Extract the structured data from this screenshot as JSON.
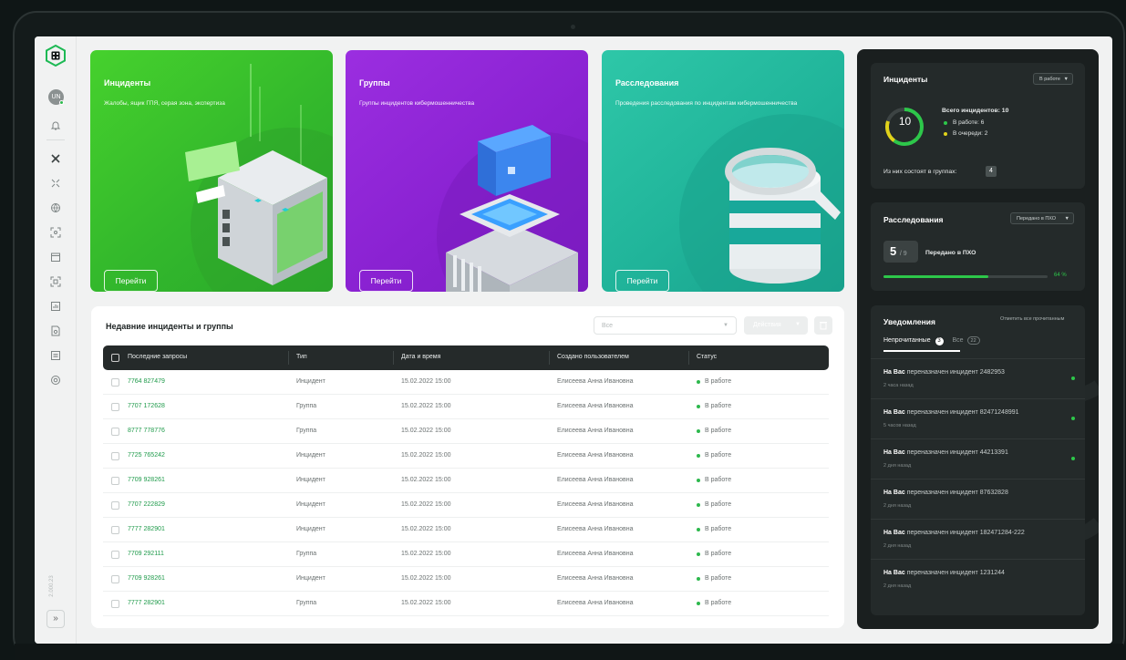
{
  "sidebar": {
    "avatar_initials": "UN",
    "version": "2.000.23",
    "expand_label": "»"
  },
  "cards": [
    {
      "title": "Инциденты",
      "description": "Жалобы, ящик ГПЯ, серая зона, экспертиза",
      "button": "Перейти",
      "color": "#3fc72f"
    },
    {
      "title": "Группы",
      "description": "Группы инцидентов кибермошенничества",
      "button": "Перейти",
      "color": "#8b24d6"
    },
    {
      "title": "Расследования",
      "description": "Проведения расследования по инцидентам кибермошенничества",
      "button": "Перейти",
      "color": "#21b79a"
    }
  ],
  "table_panel": {
    "title": "Недавние инциденты и группы",
    "filter_value": "Все",
    "actions_label": "Действия",
    "columns": [
      "Последние запросы",
      "Тип",
      "Дата и время",
      "Создано пользователем",
      "Статус"
    ],
    "rows": [
      {
        "id": "7764 827479",
        "type": "Инцидент",
        "datetime": "15.02.2022 15:00",
        "user": "Елисеева Анна Ивановна",
        "status": "В работе"
      },
      {
        "id": "7707 172628",
        "type": "Группа",
        "datetime": "15.02.2022 15:00",
        "user": "Елисеева Анна Ивановна",
        "status": "В работе"
      },
      {
        "id": "8777 778776",
        "type": "Группа",
        "datetime": "15.02.2022 15:00",
        "user": "Елисеева Анна Ивановна",
        "status": "В работе"
      },
      {
        "id": "7725 765242",
        "type": "Инцидент",
        "datetime": "15.02.2022 15:00",
        "user": "Елисеева Анна Ивановна",
        "status": "В работе"
      },
      {
        "id": "7709 928261",
        "type": "Инцидент",
        "datetime": "15.02.2022 15:00",
        "user": "Елисеева Анна Ивановна",
        "status": "В работе"
      },
      {
        "id": "7707 222829",
        "type": "Инцидент",
        "datetime": "15.02.2022 15:00",
        "user": "Елисеева Анна Ивановна",
        "status": "В работе"
      },
      {
        "id": "7777 282901",
        "type": "Инцидент",
        "datetime": "15.02.2022 15:00",
        "user": "Елисеева Анна Ивановна",
        "status": "В работе"
      },
      {
        "id": "7709 292111",
        "type": "Группа",
        "datetime": "15.02.2022 15:00",
        "user": "Елисеева Анна Ивановна",
        "status": "В работе"
      },
      {
        "id": "7709 928261",
        "type": "Инцидент",
        "datetime": "15.02.2022 15:00",
        "user": "Елисеева Анна Ивановна",
        "status": "В работе"
      },
      {
        "id": "7777 282901",
        "type": "Группа",
        "datetime": "15.02.2022 15:00",
        "user": "Елисеева Анна Ивановна",
        "status": "В работе"
      }
    ]
  },
  "incidents_widget": {
    "title": "Инциденты",
    "dropdown": "В работе",
    "total": "10",
    "total_label": "Всего инцидентов: 10",
    "in_work": "В работе: 6",
    "in_queue": "В очереди: 2",
    "in_work_fraction": 0.6,
    "in_queue_fraction": 0.2,
    "in_groups_label": "Из них состоят в группах:",
    "in_groups_count": "4",
    "colors": {
      "in_work": "#2dc74a",
      "in_queue": "#e0d21a"
    }
  },
  "investigations_widget": {
    "title": "Расследования",
    "dropdown": "Передано в ПХО",
    "done": "5",
    "total": "/ 9",
    "label": "Передано в ПХО",
    "progress_percent": "64 %",
    "progress_value": 64
  },
  "notifications": {
    "title": "Уведомления",
    "mark_all": "Отметить все прочитанным",
    "tab_unread": "Непрочитанные",
    "tab_unread_count": "3",
    "tab_all": "Все",
    "tab_all_count": "22",
    "prefix": "На Вас",
    "items": [
      {
        "text": "переназначен инцидент 2482953",
        "time": "2 часа назад",
        "unread": true
      },
      {
        "text": "переназначен инцидент 82471248991",
        "time": "5 часов назад",
        "unread": true
      },
      {
        "text": "переназначен инцидент 44213391",
        "time": "2 дня назад",
        "unread": true
      },
      {
        "text": "переназначен инцидент 87632828",
        "time": "2 дня назад",
        "unread": false
      },
      {
        "text": "переназначен инцидент 182471284-222",
        "time": "2 дня назад",
        "unread": false
      },
      {
        "text": "переназначен инцидент 1231244",
        "time": "2 дня назад",
        "unread": false
      }
    ]
  }
}
